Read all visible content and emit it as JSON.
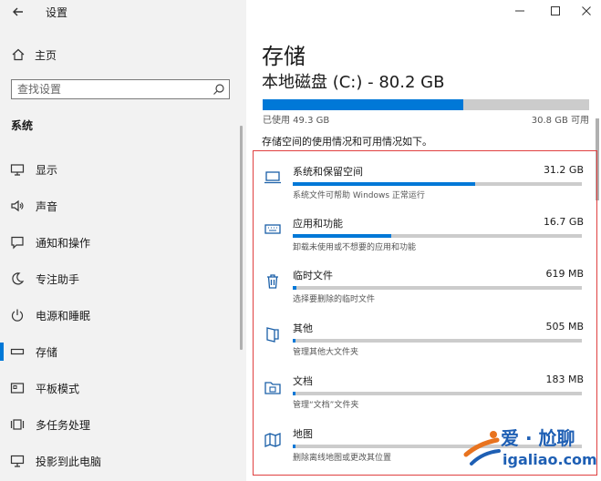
{
  "window": {
    "title": "设置",
    "back_icon": "back-arrow-icon"
  },
  "sidebar": {
    "home_label": "主页",
    "search_placeholder": "查找设置",
    "section_label": "系统",
    "items": [
      {
        "label": "显示",
        "icon": "monitor-icon"
      },
      {
        "label": "声音",
        "icon": "speaker-icon"
      },
      {
        "label": "通知和操作",
        "icon": "notification-icon"
      },
      {
        "label": "专注助手",
        "icon": "moon-icon"
      },
      {
        "label": "电源和睡眠",
        "icon": "power-icon"
      },
      {
        "label": "存储",
        "icon": "storage-icon",
        "selected": true
      },
      {
        "label": "平板模式",
        "icon": "tablet-icon"
      },
      {
        "label": "多任务处理",
        "icon": "multitask-icon"
      },
      {
        "label": "投影到此电脑",
        "icon": "project-icon"
      }
    ]
  },
  "main": {
    "title": "存储",
    "disk_label": "本地磁盘 (C:) - 80.2 GB",
    "used_label": "已使用 49.3 GB",
    "free_label": "30.8 GB 可用",
    "used_fraction": 0.615,
    "description": "存储空间的使用情况和可用情况如下。",
    "categories": [
      {
        "name": "系统和保留空间",
        "size": "31.2 GB",
        "desc": "系统文件可帮助 Windows 正常运行",
        "fraction": 0.63,
        "icon": "laptop-icon"
      },
      {
        "name": "应用和功能",
        "size": "16.7 GB",
        "desc": "卸载未使用或不想要的应用和功能",
        "fraction": 0.34,
        "icon": "keyboard-icon"
      },
      {
        "name": "临时文件",
        "size": "619 MB",
        "desc": "选择要删除的临时文件",
        "fraction": 0.013,
        "icon": "trash-icon"
      },
      {
        "name": "其他",
        "size": "505 MB",
        "desc": "管理其他大文件夹",
        "fraction": 0.01,
        "icon": "other-icon"
      },
      {
        "name": "文档",
        "size": "183 MB",
        "desc": "管理“文档”文件夹",
        "fraction": 0.005,
        "icon": "documents-icon"
      },
      {
        "name": "地图",
        "size": "",
        "desc": "删除离线地图或更改其位置",
        "fraction": 0.003,
        "icon": "map-icon"
      }
    ]
  },
  "watermark": {
    "text": "爱 · 尬聊",
    "url": "igaliao.com"
  },
  "colors": {
    "accent": "#0078d7",
    "highlight_border": "#e04040",
    "sidebar_bg": "#f2f2f2"
  }
}
